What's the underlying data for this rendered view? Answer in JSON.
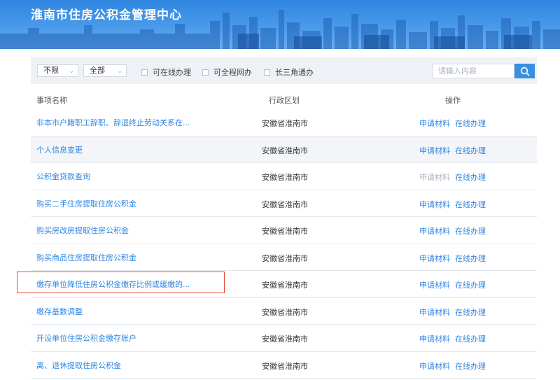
{
  "banner": {
    "title": "淮南市住房公积金管理中心"
  },
  "filters": {
    "select1": "不限",
    "select2": "全部",
    "checks": [
      "可在线办理",
      "可全程网办",
      "长三角通办"
    ]
  },
  "search": {
    "placeholder": "请输入内容"
  },
  "table": {
    "headers": [
      "事项名称",
      "行政区划",
      "操作"
    ],
    "rows": [
      {
        "name": "非本市户籍职工辞职、辞退终止劳动关系在...",
        "region": "安徽省淮南市",
        "act1": "申请材料",
        "act2": "在线办理"
      },
      {
        "name": "个人信息变更",
        "region": "安徽省淮南市",
        "act1": "申请材料",
        "act2": "在线办理"
      },
      {
        "name": "公积金贷款查询",
        "region": "安徽省淮南市",
        "act1": "申请材料",
        "act2": "在线办理"
      },
      {
        "name": "购买二手住房提取住房公积金",
        "region": "安徽省淮南市",
        "act1": "申请材料",
        "act2": "在线办理"
      },
      {
        "name": "购买房改房提取住房公积金",
        "region": "安徽省淮南市",
        "act1": "申请材料",
        "act2": "在线办理"
      },
      {
        "name": "购买商品住房提取住房公积金",
        "region": "安徽省淮南市",
        "act1": "申请材料",
        "act2": "在线办理"
      },
      {
        "name": "缴存单位降低住房公积金缴存比例或缓缴的...",
        "region": "安徽省淮南市",
        "act1": "申请材料",
        "act2": "在线办理"
      },
      {
        "name": "缴存基数调整",
        "region": "安徽省淮南市",
        "act1": "申请材料",
        "act2": "在线办理"
      },
      {
        "name": "开设单位住房公积金缴存账户",
        "region": "安徽省淮南市",
        "act1": "申请材料",
        "act2": "在线办理"
      },
      {
        "name": "离、退休提取住房公积金",
        "region": "安徽省淮南市",
        "act1": "申请材料",
        "act2": "在线办理"
      }
    ]
  },
  "colors": {
    "accent": "#2f86e0",
    "highlight": "#e8473a"
  },
  "icons": {
    "search": "search-icon",
    "dropdown": "chevron-down-icon"
  }
}
